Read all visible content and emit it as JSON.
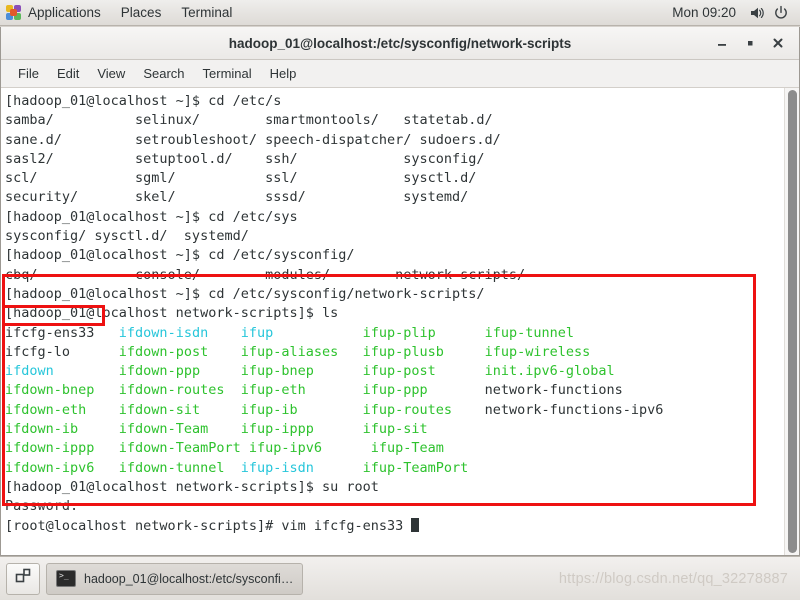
{
  "top_panel": {
    "app_icon": "applications-puzzle-icon",
    "items": [
      "Applications",
      "Places",
      "Terminal"
    ],
    "clock": "Mon 09:20",
    "volume_icon": "speaker-icon",
    "power_icon": "power-icon"
  },
  "window": {
    "title": "hadoop_01@localhost:/etc/sysconfig/network-scripts",
    "minimize_label": "–",
    "maximize_label": "▫",
    "close_label": "✕",
    "menu": [
      "File",
      "Edit",
      "View",
      "Search",
      "Terminal",
      "Help"
    ]
  },
  "colors": {
    "annotation_red": "#ee1111",
    "dir_blue": "#26c6da",
    "exec_green": "#2ec22e",
    "plain_white": "#2e3436",
    "terminal_bg": "#ffffff"
  },
  "terminal": {
    "lines": [
      {
        "id": "l01",
        "segs": [
          {
            "t": "[hadoop_01@localhost ~]$ cd /etc/s",
            "c": "white"
          }
        ]
      },
      {
        "id": "l02",
        "segs": [
          {
            "t": "samba/          selinux/        smartmontools/   statetab.d/",
            "c": "white"
          }
        ]
      },
      {
        "id": "l03",
        "segs": [
          {
            "t": "sane.d/         setroubleshoot/ speech-dispatcher/ sudoers.d/",
            "c": "white"
          }
        ]
      },
      {
        "id": "l04",
        "segs": [
          {
            "t": "sasl2/          setuptool.d/    ssh/             sysconfig/",
            "c": "white"
          }
        ]
      },
      {
        "id": "l05",
        "segs": [
          {
            "t": "scl/            sgml/           ssl/             sysctl.d/",
            "c": "white"
          }
        ]
      },
      {
        "id": "l06",
        "segs": [
          {
            "t": "security/       skel/           sssd/            systemd/",
            "c": "white"
          }
        ]
      },
      {
        "id": "l07",
        "segs": [
          {
            "t": "[hadoop_01@localhost ~]$ cd /etc/sys",
            "c": "white"
          }
        ]
      },
      {
        "id": "l08",
        "segs": [
          {
            "t": "sysconfig/ sysctl.d/  systemd/",
            "c": "white"
          }
        ]
      },
      {
        "id": "l09",
        "segs": [
          {
            "t": "[hadoop_01@localhost ~]$ cd /etc/sysconfig/",
            "c": "white"
          }
        ]
      },
      {
        "id": "l10",
        "segs": [
          {
            "t": "cbq/            console/        modules/        network-scripts/",
            "c": "white"
          }
        ]
      },
      {
        "id": "l11",
        "segs": [
          {
            "t": "[hadoop_01@localhost ~]$ cd /etc/sysconfig/network-scripts/",
            "c": "white"
          }
        ]
      },
      {
        "id": "l12",
        "segs": [
          {
            "t": "[hadoop_01@localhost network-scripts]$ ls",
            "c": "white"
          }
        ]
      },
      {
        "id": "l13",
        "segs": [
          {
            "t": "ifcfg-ens33   ",
            "c": "white"
          },
          {
            "t": "ifdown-isdn    ",
            "c": "cyan"
          },
          {
            "t": "ifup           ",
            "c": "cyan"
          },
          {
            "t": "ifup-plip      ",
            "c": "green"
          },
          {
            "t": "ifup-tunnel",
            "c": "green"
          }
        ]
      },
      {
        "id": "l14",
        "segs": [
          {
            "t": "ifcfg-lo      ",
            "c": "white"
          },
          {
            "t": "ifdown-post    ",
            "c": "green"
          },
          {
            "t": "ifup-aliases   ",
            "c": "green"
          },
          {
            "t": "ifup-plusb     ",
            "c": "green"
          },
          {
            "t": "ifup-wireless",
            "c": "green"
          }
        ]
      },
      {
        "id": "l15",
        "segs": [
          {
            "t": "ifdown        ",
            "c": "cyan"
          },
          {
            "t": "ifdown-ppp     ",
            "c": "green"
          },
          {
            "t": "ifup-bnep      ",
            "c": "green"
          },
          {
            "t": "ifup-post      ",
            "c": "green"
          },
          {
            "t": "init.ipv6-global",
            "c": "green"
          }
        ]
      },
      {
        "id": "l16",
        "segs": [
          {
            "t": "ifdown-bnep   ",
            "c": "green"
          },
          {
            "t": "ifdown-routes  ",
            "c": "green"
          },
          {
            "t": "ifup-eth       ",
            "c": "green"
          },
          {
            "t": "ifup-ppp       ",
            "c": "green"
          },
          {
            "t": "network-functions",
            "c": "white"
          }
        ]
      },
      {
        "id": "l17",
        "segs": [
          {
            "t": "ifdown-eth    ",
            "c": "green"
          },
          {
            "t": "ifdown-sit     ",
            "c": "green"
          },
          {
            "t": "ifup-ib        ",
            "c": "green"
          },
          {
            "t": "ifup-routes    ",
            "c": "green"
          },
          {
            "t": "network-functions-ipv6",
            "c": "white"
          }
        ]
      },
      {
        "id": "l18",
        "segs": [
          {
            "t": "ifdown-ib     ",
            "c": "green"
          },
          {
            "t": "ifdown-Team    ",
            "c": "green"
          },
          {
            "t": "ifup-ippp      ",
            "c": "green"
          },
          {
            "t": "ifup-sit",
            "c": "green"
          }
        ]
      },
      {
        "id": "l19",
        "segs": [
          {
            "t": "ifdown-ippp   ",
            "c": "green"
          },
          {
            "t": "ifdown-TeamPort",
            "c": "green"
          },
          {
            "t": " ifup-ipv6      ",
            "c": "green"
          },
          {
            "t": "ifup-Team",
            "c": "green"
          }
        ]
      },
      {
        "id": "l20",
        "segs": [
          {
            "t": "ifdown-ipv6   ",
            "c": "green"
          },
          {
            "t": "ifdown-tunnel  ",
            "c": "green"
          },
          {
            "t": "ifup-isdn      ",
            "c": "cyan"
          },
          {
            "t": "ifup-TeamPort",
            "c": "green"
          }
        ]
      },
      {
        "id": "l21",
        "segs": [
          {
            "t": "[hadoop_01@localhost network-scripts]$ su root",
            "c": "white"
          }
        ]
      },
      {
        "id": "l22",
        "segs": [
          {
            "t": "Password:",
            "c": "white"
          }
        ]
      },
      {
        "id": "l23",
        "segs": [
          {
            "t": "[root@localhost network-scripts]# vim ifcfg-ens33 ",
            "c": "white"
          }
        ],
        "cursor": true
      }
    ]
  },
  "annotations": {
    "main_box_label": "highlighted-command-block",
    "file_box_label": "highlighted-file-ifcfg-ens33"
  },
  "taskbar": {
    "workspace_icon": "workspace-switcher-icon",
    "task_icon": "terminal-icon",
    "task_label": "hadoop_01@localhost:/etc/sysconfi…",
    "watermark": "https://blog.csdn.net/qq_32278887"
  }
}
